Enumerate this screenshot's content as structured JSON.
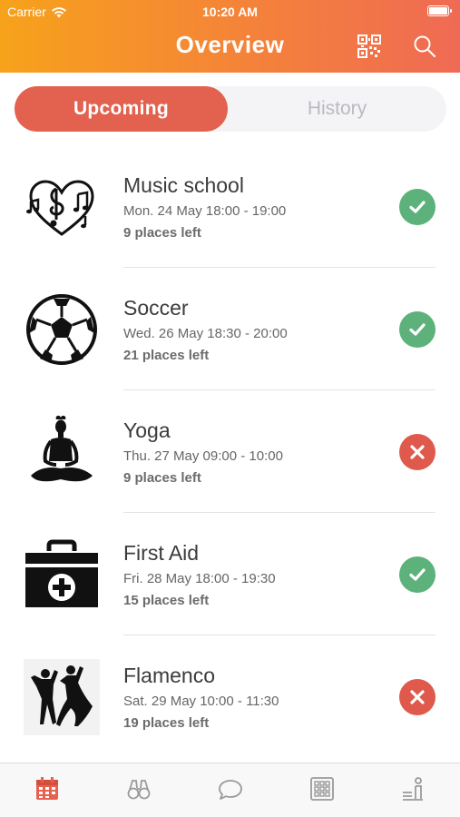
{
  "status_bar": {
    "carrier": "Carrier",
    "time": "10:20 AM"
  },
  "header": {
    "title": "Overview",
    "icons": [
      "qr-code-icon",
      "search-icon"
    ]
  },
  "tabs": {
    "upcoming": "Upcoming",
    "history": "History",
    "selected": "upcoming"
  },
  "events": [
    {
      "name": "Music school",
      "date": "Mon. 24 May 18:00 - 19:00",
      "places": "9 places left",
      "status": "confirmed",
      "icon": "music-heart-icon"
    },
    {
      "name": "Soccer",
      "date": "Wed. 26 May 18:30 - 20:00",
      "places": "21 places left",
      "status": "confirmed",
      "icon": "soccer-ball-icon"
    },
    {
      "name": "Yoga",
      "date": "Thu. 27 May 09:00 - 10:00",
      "places": "9 places left",
      "status": "declined",
      "icon": "yoga-icon"
    },
    {
      "name": "First Aid",
      "date": "Fri. 28 May 18:00 - 19:30",
      "places": "15 places left",
      "status": "confirmed",
      "icon": "first-aid-kit-icon"
    },
    {
      "name": "Flamenco",
      "date": "Sat. 29 May 10:00 - 11:30",
      "places": "19 places left",
      "status": "declined",
      "icon": "flamenco-dancers-icon"
    }
  ],
  "tab_bar": {
    "items": [
      "calendar-icon",
      "binoculars-icon",
      "chat-icon",
      "grid-icon",
      "profile-icon"
    ],
    "active": "calendar-icon"
  },
  "colors": {
    "header_gradient_start": "#f7a21b",
    "header_gradient_end": "#ef6a54",
    "segment_active": "#e2614f",
    "confirmed": "#5cb27a",
    "declined": "#e0594d"
  }
}
